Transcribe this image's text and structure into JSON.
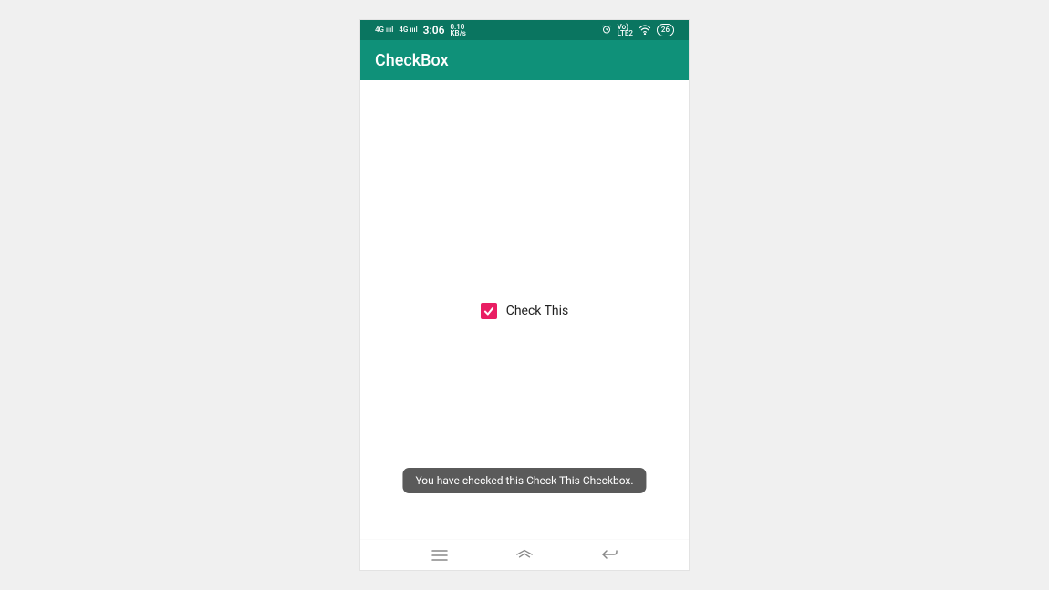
{
  "status_bar": {
    "network_label1": "4G",
    "network_label2": "4G",
    "time": "3:06",
    "speed": "0.10",
    "speed_unit": "KB/s",
    "carrier": "Vo)",
    "lte": "LTE2",
    "battery": "26"
  },
  "app_bar": {
    "title": "CheckBox"
  },
  "content": {
    "checkbox_label": "Check This",
    "checkbox_checked": true
  },
  "toast": {
    "message": "You have checked this Check This Checkbox."
  },
  "colors": {
    "status_bg": "#0a7560",
    "appbar_bg": "#0f9179",
    "checkbox_accent": "#e91e63",
    "toast_bg": "#5a5a5a"
  }
}
